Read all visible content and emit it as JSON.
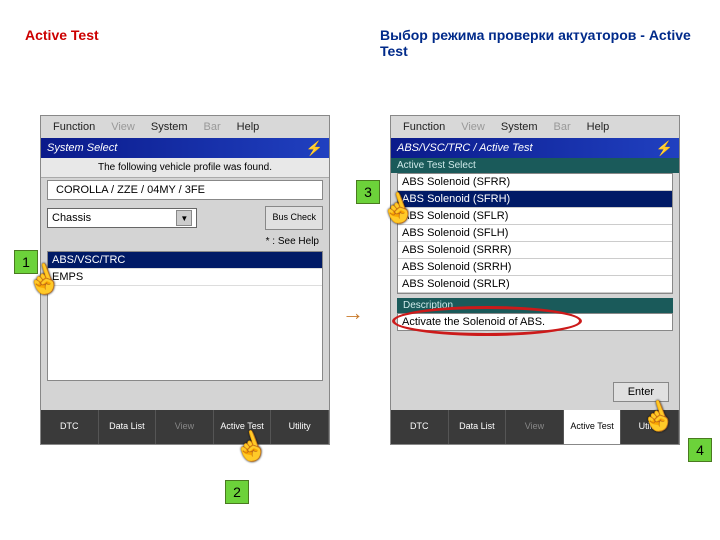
{
  "header": {
    "left": "Active Test",
    "right": "Выбор режима проверки актуаторов - Active Test"
  },
  "menubar": {
    "function": "Function",
    "view": "View",
    "system": "System",
    "bar": "Bar",
    "help": "Help"
  },
  "left": {
    "title": "System Select",
    "subtitle": "The following vehicle profile was found.",
    "vehicle": "COROLLA / ZZE / 04MY / 3FE",
    "combo": "Chassis",
    "buscheck": "Bus Check",
    "helptext": "* : See Help",
    "list": {
      "sel": "ABS/VSC/TRC",
      "item2": "EMPS"
    }
  },
  "right": {
    "title": "ABS/VSC/TRC / Active Test",
    "subhead": "Active Test Select",
    "items": {
      "i0": "ABS Solenoid (SFRR)",
      "i1": "ABS Solenoid (SFRH)",
      "i2": "ABS Solenoid (SFLR)",
      "i3": "ABS Solenoid (SFLH)",
      "i4": "ABS Solenoid (SRRR)",
      "i5": "ABS Solenoid (SRRH)",
      "i6": "ABS Solenoid (SRLR)"
    },
    "descLabel": "Description",
    "desc": "Activate the Solenoid of ABS.",
    "enter": "Enter"
  },
  "bottom": {
    "dtc": "DTC",
    "datalist": "Data List",
    "view": "View",
    "activetest": "Active Test",
    "utility": "Utility"
  },
  "callouts": {
    "c1": "1",
    "c2": "2",
    "c3": "3",
    "c4": "4"
  }
}
